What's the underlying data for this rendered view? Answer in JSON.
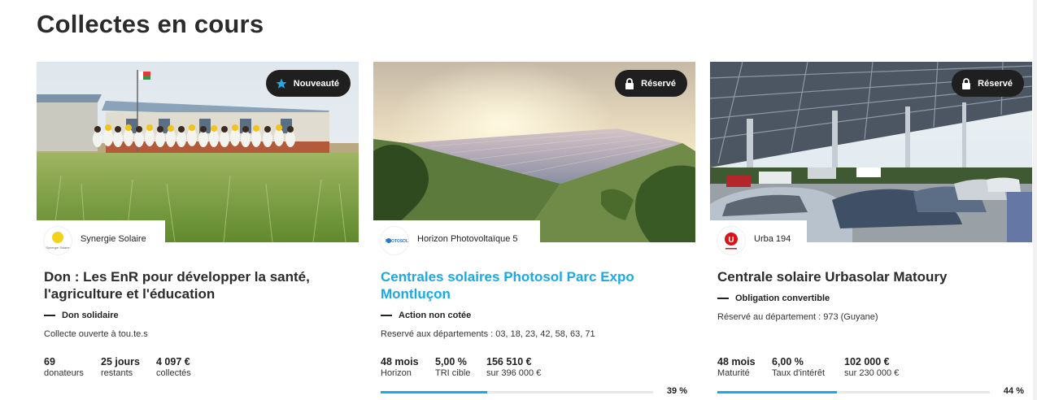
{
  "page": {
    "title": "Collectes en cours"
  },
  "cards": [
    {
      "badge": {
        "label": "Nouveauté",
        "icon": "star-icon"
      },
      "issuer": {
        "name": "Synergie Solaire",
        "logo_text": "Synergie Solaire"
      },
      "title": "Don : Les EnR pour développer la santé, l'agriculture et l'éducation",
      "type": "Don solidaire",
      "note": "Collecte ouverte à tou.te.s",
      "stats": [
        {
          "value": "69",
          "label": "donateurs"
        },
        {
          "value": "25 jours",
          "label": "restants"
        },
        {
          "value": "4 097 €",
          "label": "collectés"
        }
      ]
    },
    {
      "badge": {
        "label": "Réservé",
        "icon": "lock-icon"
      },
      "issuer": {
        "name": "Horizon Photovoltaïque 5",
        "logo_text": "PHOTOSOL"
      },
      "title": "Centrales solaires Photosol Parc Expo Montluçon",
      "type": "Action non cotée",
      "note": "Reservé aux départements : 03, 18, 23, 42, 58, 63, 71",
      "stats": [
        {
          "value": "48 mois",
          "label": "Horizon"
        },
        {
          "value": "5,00 %",
          "label": "TRI cible"
        },
        {
          "value": "156 510 €",
          "label": "sur 396 000 €"
        }
      ],
      "progress": {
        "value": 0.39,
        "label": "39 %"
      }
    },
    {
      "badge": {
        "label": "Réservé",
        "icon": "lock-icon"
      },
      "issuer": {
        "name": "Urba 194",
        "logo_text": "U"
      },
      "title": "Centrale solaire Urbasolar Matoury",
      "type": "Obligation convertible",
      "note": "Réservé au département : 973 (Guyane)",
      "stats": [
        {
          "value": "48 mois",
          "label": "Maturité"
        },
        {
          "value": "6,00 %",
          "label": "Taux d'intérêt"
        },
        {
          "value": "102 000 €",
          "label": "sur 230 000 €"
        }
      ],
      "progress": {
        "value": 0.44,
        "label": "44 %"
      }
    }
  ],
  "colors": {
    "accent": "#19a9e6",
    "badge_bg": "#1f1f1f",
    "urba_red": "#d7141a"
  }
}
